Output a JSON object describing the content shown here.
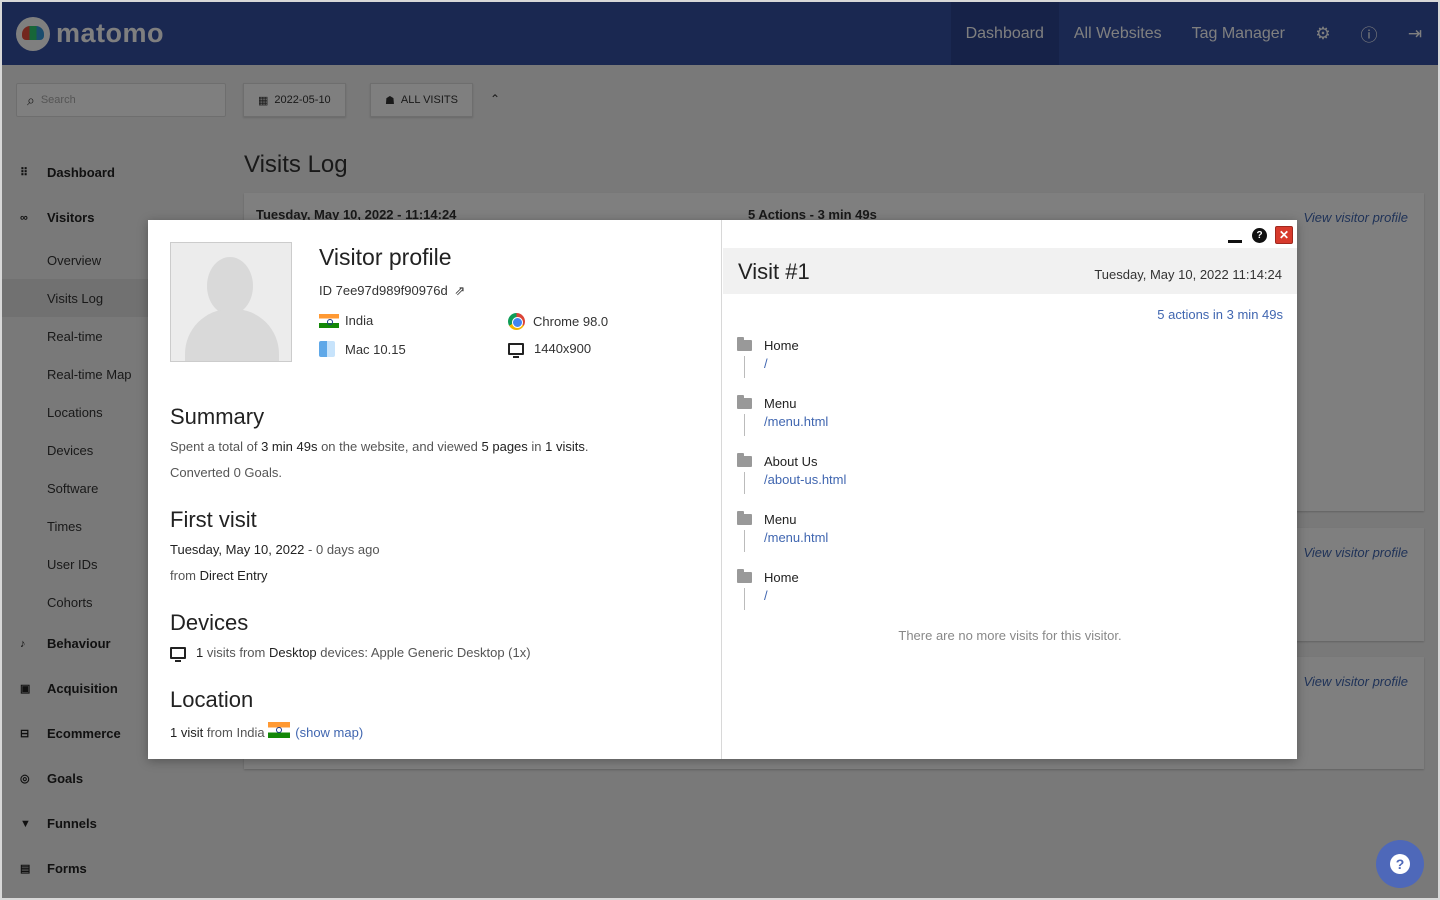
{
  "topbar": {
    "logo_text": "matomo",
    "nav": [
      "Dashboard",
      "All Websites",
      "Tag Manager"
    ],
    "icons": [
      "gear-icon",
      "info-icon",
      "sign-out-icon"
    ]
  },
  "sidebar": {
    "search_placeholder": "Search",
    "items": {
      "dashboard": "Dashboard",
      "visitors": "Visitors",
      "overview": "Overview",
      "visits_log": "Visits Log",
      "realtime": "Real-time",
      "realtime_map": "Real-time Map",
      "locations": "Locations",
      "devices": "Devices",
      "software": "Software",
      "times": "Times",
      "user_ids": "User IDs",
      "cohorts": "Cohorts",
      "behaviour": "Behaviour",
      "acquisition": "Acquisition",
      "ecommerce": "Ecommerce",
      "goals": "Goals",
      "funnels": "Funnels",
      "forms": "Forms"
    }
  },
  "main": {
    "date_button": "2022-05-10",
    "segment_button": "ALL VISITS",
    "page_title": "Visits Log",
    "first_row_title": "Tuesday, May 10, 2022 - 11:14:24",
    "first_row_actions": "5 Actions - 3 min 49s",
    "view_profile": "View visitor profile"
  },
  "profile": {
    "title": "Visitor profile",
    "id": "ID 7ee97d989f90976d",
    "country": "India",
    "browser": "Chrome 98.0",
    "os": "Mac 10.15",
    "resolution": "1440x900",
    "summary": {
      "heading": "Summary",
      "t1": "Spent a total of ",
      "duration": "3 min 49s",
      "t2": " on the website, and viewed ",
      "pages": "5 pages",
      "t3": " in ",
      "visits": "1 visits",
      "t4": ".",
      "converted": "Converted 0 Goals."
    },
    "first_visit": {
      "heading": "First visit",
      "date": "Tuesday, May 10, 2022",
      "ago": " - 0 days ago",
      "from_label": "from ",
      "from_value": "Direct Entry"
    },
    "devices": {
      "heading": "Devices",
      "count": "1",
      "t1": " visits from ",
      "type": "Desktop",
      "t2": " devices: Apple Generic Desktop (1x)"
    },
    "location": {
      "heading": "Location",
      "count": "1 visit",
      "t1": " from India ",
      "show_map": "(show map)"
    }
  },
  "visit": {
    "title": "Visit #1",
    "datetime": "Tuesday, May 10, 2022 11:14:24",
    "summary": "5 actions in 3 min 49s",
    "actions": [
      {
        "title": "Home",
        "url": "/"
      },
      {
        "title": "Menu",
        "url": "/menu.html"
      },
      {
        "title": "About Us",
        "url": "/about-us.html"
      },
      {
        "title": "Menu",
        "url": "/menu.html"
      },
      {
        "title": "Home",
        "url": "/"
      }
    ],
    "no_more": "There are no more visits for this visitor."
  },
  "colors": {
    "brand": "#3450a3",
    "link": "#4066b0",
    "close": "#d73a2c"
  }
}
